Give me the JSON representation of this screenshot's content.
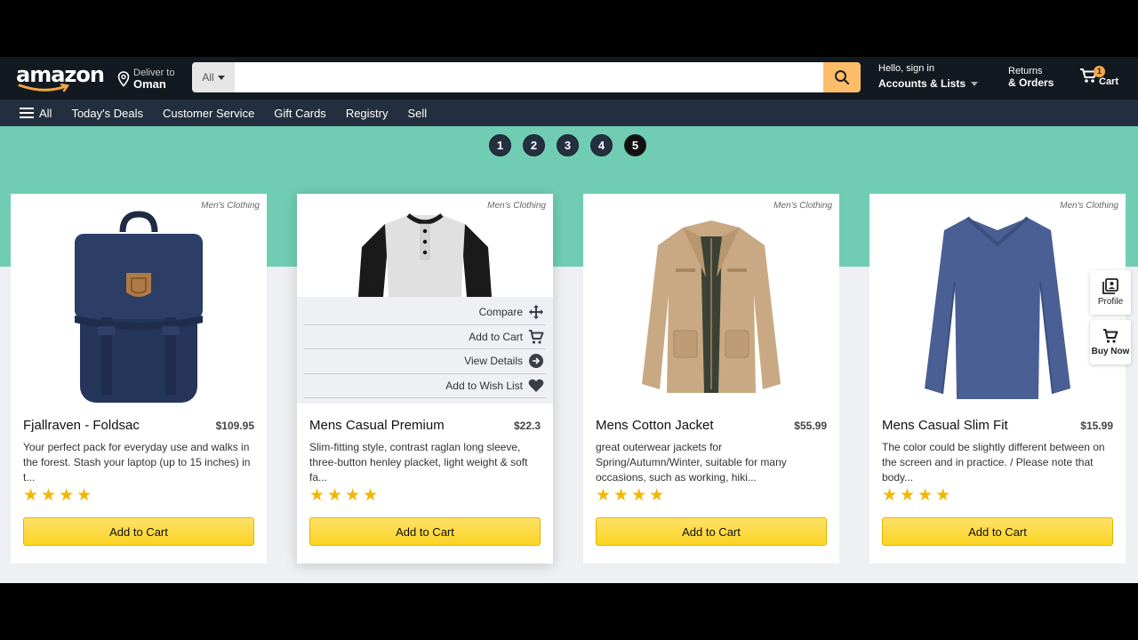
{
  "header": {
    "logo": "amazon",
    "deliver_small": "Deliver to",
    "deliver_location": "Oman",
    "search_category": "All",
    "search_placeholder": "",
    "account_small": "Hello, sign in",
    "account_bold": "Accounts & Lists",
    "returns_small": "Returns",
    "orders_bold": "& Orders",
    "cart_count": "1",
    "cart_label": "Cart"
  },
  "nav": {
    "all": "All",
    "items": [
      "Today's Deals",
      "Customer Service",
      "Gift Cards",
      "Registry",
      "Sell"
    ]
  },
  "pager": [
    "1",
    "2",
    "3",
    "4",
    "5"
  ],
  "pager_active": "5",
  "hover_menu": {
    "compare": "Compare",
    "add_to_cart": "Add to Cart",
    "view_details": "View Details",
    "add_to_wish_list": "Add to Wish List"
  },
  "products": [
    {
      "category": "Men's Clothing",
      "title": "Fjallraven - Foldsac",
      "price": "$109.95",
      "description": "Your perfect pack for everyday use and walks in the forest. Stash your laptop (up to 15 inches) in t...",
      "stars": 4,
      "button": "Add to Cart"
    },
    {
      "category": "Men's Clothing",
      "title": "Mens Casual Premium",
      "price": "$22.3",
      "description": "Slim-fitting style, contrast raglan long sleeve, three-button henley placket, light weight & soft fa...",
      "stars": 4,
      "button": "Add to Cart"
    },
    {
      "category": "Men's Clothing",
      "title": "Mens Cotton Jacket",
      "price": "$55.99",
      "description": "great outerwear jackets for Spring/Autumn/Winter, suitable for many occasions, such as working, hiki...",
      "stars": 4,
      "button": "Add to Cart"
    },
    {
      "category": "Men's Clothing",
      "title": "Mens Casual Slim Fit",
      "price": "$15.99",
      "description": "The color could be slightly different between on the screen and in practice. / Please note that body...",
      "stars": 4,
      "button": "Add to Cart"
    }
  ],
  "side_buttons": {
    "profile": "Profile",
    "buy_now": "Buy Now"
  },
  "colors": {
    "header_bg": "#131921",
    "subnav_bg": "#232f3e",
    "band": "#70cdb3",
    "search_button": "#febd69",
    "cart_badge": "#f3a847",
    "star": "#f0b800",
    "button_yellow": "#fbd422"
  }
}
